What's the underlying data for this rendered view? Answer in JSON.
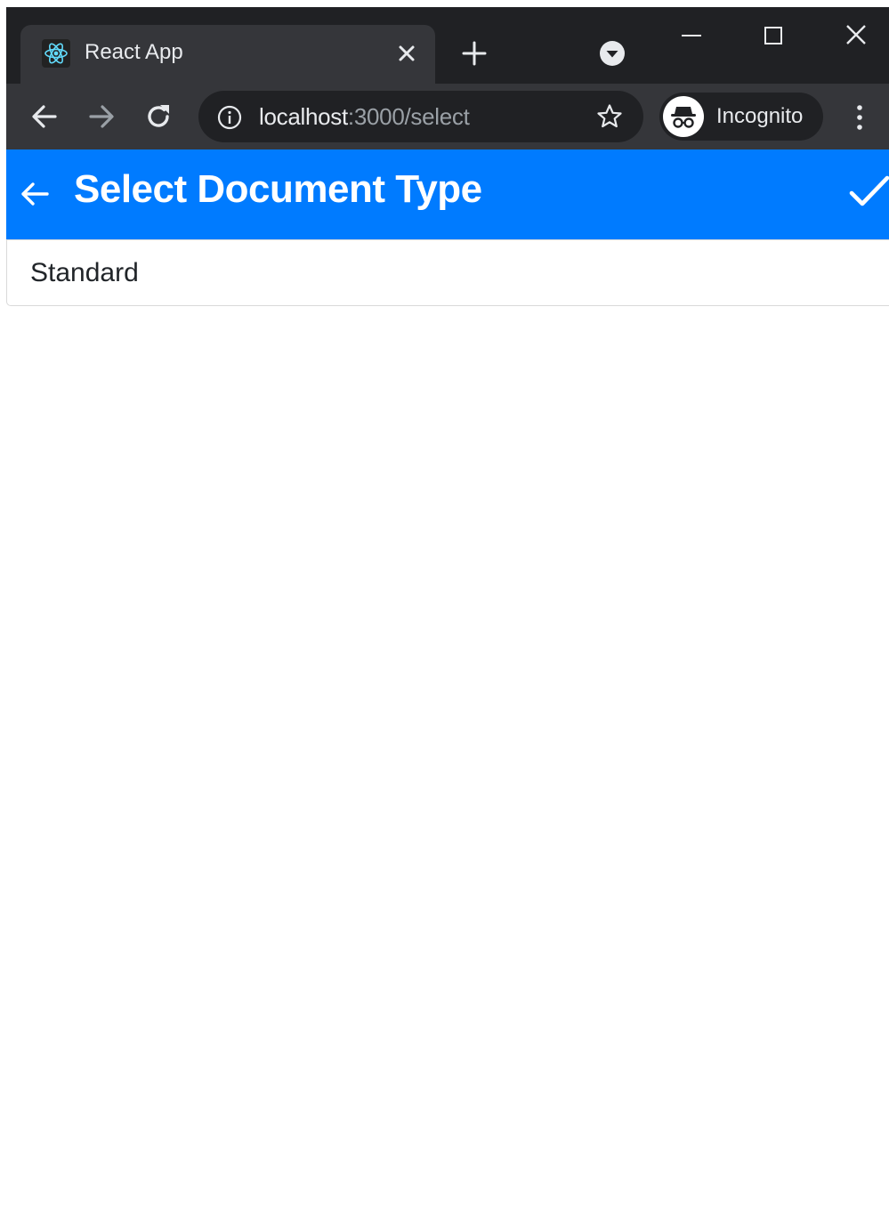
{
  "browser": {
    "tab": {
      "title": "React App",
      "favicon": "react-logo-icon"
    },
    "address_bar": {
      "url_host": "localhost",
      "url_path": ":3000/select"
    },
    "profile": {
      "label": "Incognito",
      "icon": "incognito-icon"
    },
    "colors": {
      "frame": "#202124",
      "toolbar": "#35363a",
      "text": "#e8eaed",
      "muted_text": "#9aa0a6"
    }
  },
  "app_bar": {
    "title": "Select Document Type",
    "back_icon": "arrow-left-icon",
    "confirm_icon": "check-icon",
    "color": "#007bff"
  },
  "options": [
    {
      "label": "Standard"
    }
  ]
}
